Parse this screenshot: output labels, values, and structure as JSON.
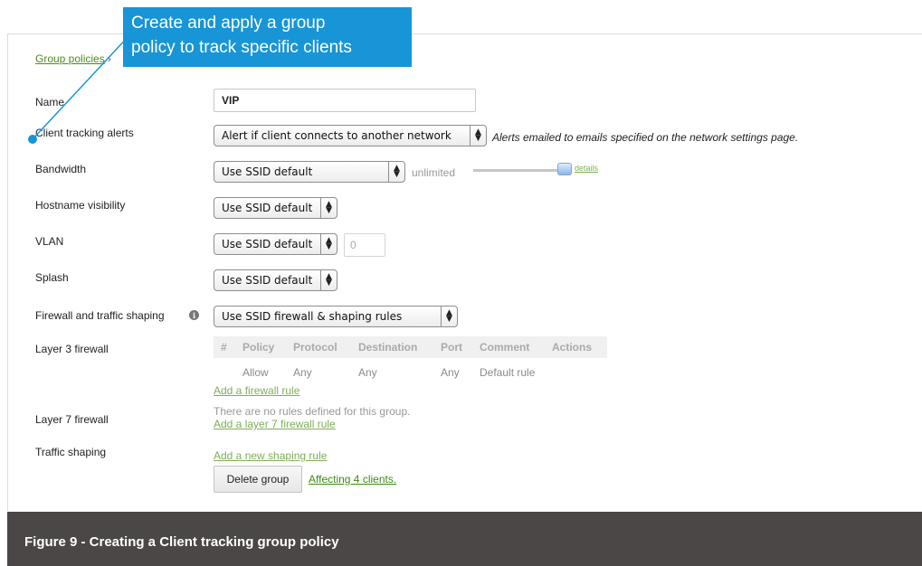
{
  "breadcrumb": {
    "link": "Group policies",
    "separator": "›"
  },
  "callout": {
    "line1": "Create and apply a group",
    "line2": "policy to track specific clients"
  },
  "labels": {
    "name": "Name",
    "client_tracking": "Client tracking alerts",
    "bandwidth": "Bandwidth",
    "hostname": "Hostname visibility",
    "vlan": "VLAN",
    "splash": "Splash",
    "firewall_shaping": "Firewall and traffic shaping",
    "layer3": "Layer 3 firewall",
    "layer7": "Layer 7 firewall",
    "traffic_shaping": "Traffic shaping"
  },
  "fields": {
    "name_value": "VIP",
    "client_tracking_select": "Alert if client connects to another network",
    "client_tracking_hint": "Alerts emailed to emails specified on the network settings page.",
    "bandwidth_select": "Use SSID default",
    "bandwidth_limit": "unlimited",
    "bandwidth_level": 1.0,
    "details_link": "details",
    "hostname_select": "Use SSID default",
    "vlan_select": "Use SSID default",
    "vlan_value": "0",
    "splash_select": "Use SSID default",
    "firewall_select": "Use SSID firewall & shaping rules"
  },
  "firewall_table": {
    "headers": [
      "#",
      "Policy",
      "Protocol",
      "Destination",
      "Port",
      "Comment",
      "Actions"
    ],
    "rows": [
      [
        "",
        "Allow",
        "Any",
        "Any",
        "Any",
        "Default rule",
        ""
      ]
    ]
  },
  "links": {
    "add_firewall_rule": "Add a firewall rule",
    "layer7_empty": "There are no rules defined for this group.",
    "add_layer7_rule": "Add a layer 7 firewall rule",
    "add_shaping_rule": "Add a new shaping rule"
  },
  "actions": {
    "delete_group": "Delete group",
    "affecting": "Affecting 4 clients."
  },
  "caption": "Figure 9 - Creating a Client tracking group policy",
  "colors": {
    "callout": "#1895d6",
    "link_green": "#7fae58",
    "caption_bg": "#4a4746"
  }
}
